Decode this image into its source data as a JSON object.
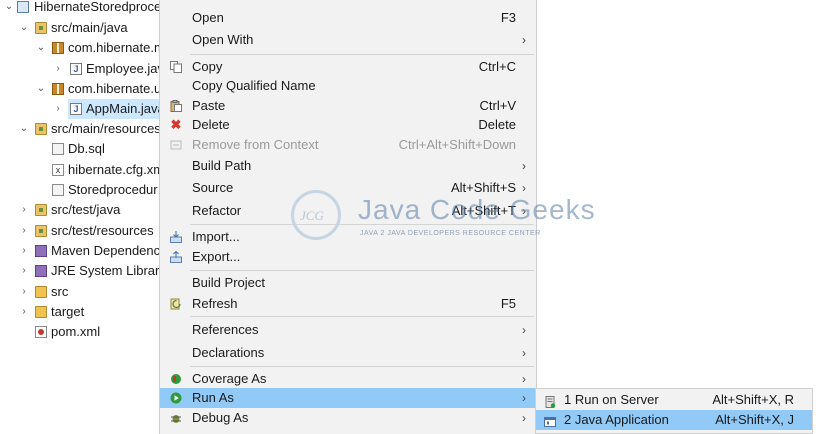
{
  "tree": {
    "rows": [
      {
        "label": "HibernateStoredproce",
        "arrow": "⌄",
        "icon": "project-icon"
      },
      {
        "label": "src/main/java",
        "arrow": "⌄",
        "icon": "source-folder-icon"
      },
      {
        "label": "com.hibernate.m",
        "arrow": "⌄",
        "icon": "package-icon"
      },
      {
        "label": "Employee.java",
        "arrow": "›",
        "icon": "java-file-icon"
      },
      {
        "label": "com.hibernate.u",
        "arrow": "⌄",
        "icon": "package-icon"
      },
      {
        "label": "AppMain.java",
        "arrow": "›",
        "icon": "java-file-icon"
      },
      {
        "label": "src/main/resources",
        "arrow": "⌄",
        "icon": "source-folder-icon"
      },
      {
        "label": "Db.sql",
        "arrow": "",
        "icon": "file-icon"
      },
      {
        "label": "hibernate.cfg.xml",
        "arrow": "",
        "icon": "xml-file-icon"
      },
      {
        "label": "Storedprocedur",
        "arrow": "",
        "icon": "file-icon"
      },
      {
        "label": "src/test/java",
        "arrow": "›",
        "icon": "source-folder-icon"
      },
      {
        "label": "src/test/resources",
        "arrow": "›",
        "icon": "source-folder-icon"
      },
      {
        "label": "Maven Dependenc",
        "arrow": "›",
        "icon": "library-icon"
      },
      {
        "label": "JRE System Library",
        "arrow": "›",
        "icon": "library-icon"
      },
      {
        "label": "src",
        "arrow": "›",
        "icon": "folder-icon"
      },
      {
        "label": "target",
        "arrow": "›",
        "icon": "folder-icon"
      },
      {
        "label": "pom.xml",
        "arrow": "",
        "icon": "pom-file-icon"
      }
    ]
  },
  "menu": {
    "items": [
      {
        "label": "Open",
        "shortcut": "F3"
      },
      {
        "label": "Open With",
        "shortcut": "",
        "submenu": "›"
      },
      {
        "label": "Copy",
        "shortcut": "Ctrl+C"
      },
      {
        "label": "Copy Qualified Name",
        "shortcut": ""
      },
      {
        "label": "Paste",
        "shortcut": "Ctrl+V"
      },
      {
        "label": "Delete",
        "shortcut": "Delete"
      },
      {
        "label": "Remove from Context",
        "shortcut": "Ctrl+Alt+Shift+Down"
      },
      {
        "label": "Build Path",
        "shortcut": "",
        "submenu": "›"
      },
      {
        "label": "Source",
        "shortcut": "Alt+Shift+S",
        "submenu": "›"
      },
      {
        "label": "Refactor",
        "shortcut": "Alt+Shift+T",
        "submenu": "›"
      },
      {
        "label": "Import...",
        "shortcut": ""
      },
      {
        "label": "Export...",
        "shortcut": ""
      },
      {
        "label": "Build Project",
        "shortcut": ""
      },
      {
        "label": "Refresh",
        "shortcut": "F5"
      },
      {
        "label": "References",
        "shortcut": "",
        "submenu": "›"
      },
      {
        "label": "Declarations",
        "shortcut": "",
        "submenu": "›"
      },
      {
        "label": "Coverage As",
        "shortcut": "",
        "submenu": "›"
      },
      {
        "label": "Run As",
        "shortcut": "",
        "submenu": "›"
      },
      {
        "label": "Debug As",
        "shortcut": "",
        "submenu": "›"
      }
    ]
  },
  "submenu": {
    "items": [
      {
        "label": "1 Run on Server",
        "shortcut": "Alt+Shift+X, R"
      },
      {
        "label": "2 Java Application",
        "shortcut": "Alt+Shift+X, J"
      }
    ]
  },
  "watermark": {
    "logo": "JCG",
    "brand": "Java Code Geeks",
    "tagline": "JAVA 2 JAVA DEVELOPERS RESOURCE CENTER"
  },
  "colors": {
    "selection": "#cce8ff",
    "menu_highlight": "#91c9f7",
    "menu_background": "#f2f2f2",
    "delete_icon": "#d9342b",
    "run_icon": "#2e9b3c"
  }
}
